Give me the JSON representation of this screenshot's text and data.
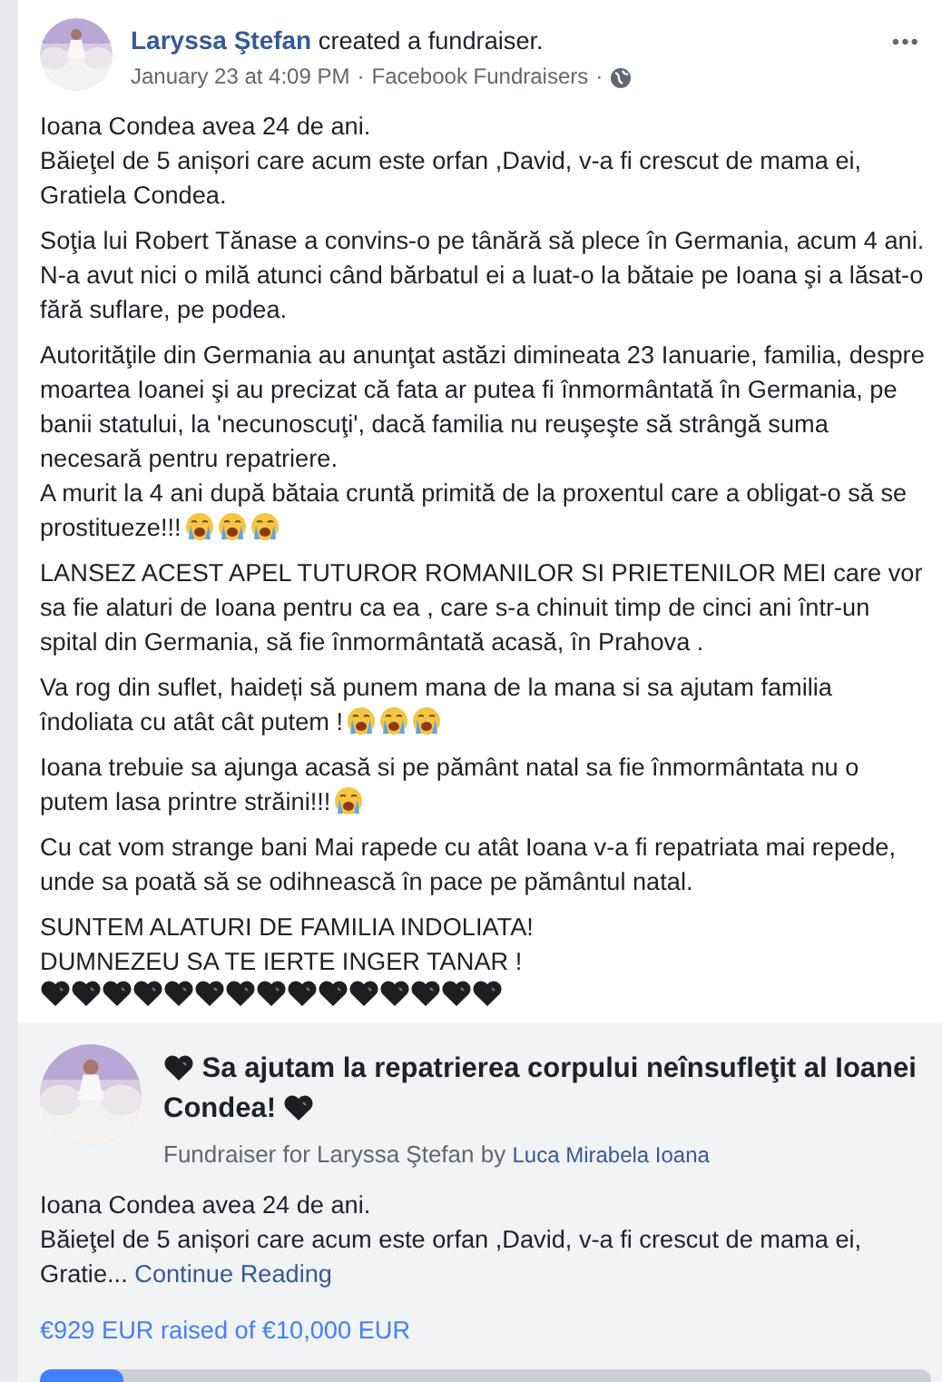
{
  "post": {
    "author": "Laryssa Ştefan",
    "action": "created a fundraiser.",
    "time": "January 23 at 4:09 PM",
    "separators": [
      "·",
      "·"
    ],
    "source": "Facebook Fundraisers",
    "more": "•••",
    "paragraphs": [
      {
        "text": "Ioana Condea avea 24 de ani.\nBăieţel de 5 anișori care acum este orfan ,David, v-a fi crescut de mama ei, Gratiela Condea."
      },
      {
        "text": "Soţia lui Robert Tănase a convins-o pe tânără să plece în Germania, acum 4 ani. N-a avut nici o milă atunci când bărbatul ei a luat-o la bătaie pe Ioana şi a lăsat-o fără suflare, pe podea."
      },
      {
        "text": "Autorităţile din Germania au anunţat astăzi dimineata 23 Ianuarie, familia, despre moartea Ioanei şi au precizat că fata ar putea fi înmormântată în Germania, pe banii statului, la 'necunoscuţi', dacă familia nu reuşeşte să strângă suma necesară pentru repatriere.\nA murit la 4 ani după bătaia cruntă primită de la proxentul care a obligat-o să se prostitueze!!!",
        "icons": [
          {
            "kind": "crying"
          },
          {
            "kind": "crying"
          },
          {
            "kind": "crying"
          }
        ]
      },
      {
        "text": "LANSEZ ACEST APEL TUTUROR ROMANILOR SI PRIETENILOR MEI care vor sa fie alaturi de Ioana pentru ca ea , care s-a chinuit timp de cinci ani într-un spital din Germania, să fie înmormântată acasă, în Prahova ."
      },
      {
        "text": "Va rog din suflet, haideți să punem mana de la mana si sa ajutam familia îndoliata cu atât cât putem !",
        "icons": [
          {
            "kind": "crying"
          },
          {
            "kind": "crying"
          },
          {
            "kind": "crying"
          }
        ]
      },
      {
        "text": "Ioana trebuie sa ajunga acasă si pe pământ natal sa fie înmormântata nu o putem lasa printre străini!!!",
        "icons": [
          {
            "kind": "crying"
          }
        ]
      },
      {
        "text": "Cu cat vom strange bani Mai rapede cu atât Ioana v-a fi repatriata mai repede, unde sa poată să se odihnească în pace pe pământul natal."
      },
      {
        "text": "SUNTEM ALATURI DE FAMILIA INDOLIATA!\nDUMNEZEU SA TE IERTE INGER TANAR !",
        "icon_row": [
          {
            "kind": "black_heart"
          },
          {
            "kind": "black_heart"
          },
          {
            "kind": "black_heart"
          },
          {
            "kind": "black_heart"
          },
          {
            "kind": "black_heart"
          },
          {
            "kind": "black_heart"
          },
          {
            "kind": "black_heart"
          },
          {
            "kind": "black_heart"
          },
          {
            "kind": "black_heart"
          },
          {
            "kind": "black_heart"
          },
          {
            "kind": "black_heart"
          },
          {
            "kind": "black_heart"
          },
          {
            "kind": "black_heart"
          },
          {
            "kind": "black_heart"
          },
          {
            "kind": "black_heart"
          }
        ]
      }
    ]
  },
  "fundraiser": {
    "title": "Sa ajutam la repatrierea corpului neînsufleţit al Ioanei Condea!",
    "subtitle": "Fundraiser for Laryssa Ştefan by",
    "organizer": "Luca Mirabela Ioana",
    "excerpt": "Ioana Condea avea 24 de ani.\nBăieţel de 5 anișori care acum este orfan ,David, v-a fi crescut de mama ei, Gratie...",
    "continue": "Continue Reading",
    "raised": "€929 EUR raised of €10,000 EUR",
    "level": 0.093
  }
}
